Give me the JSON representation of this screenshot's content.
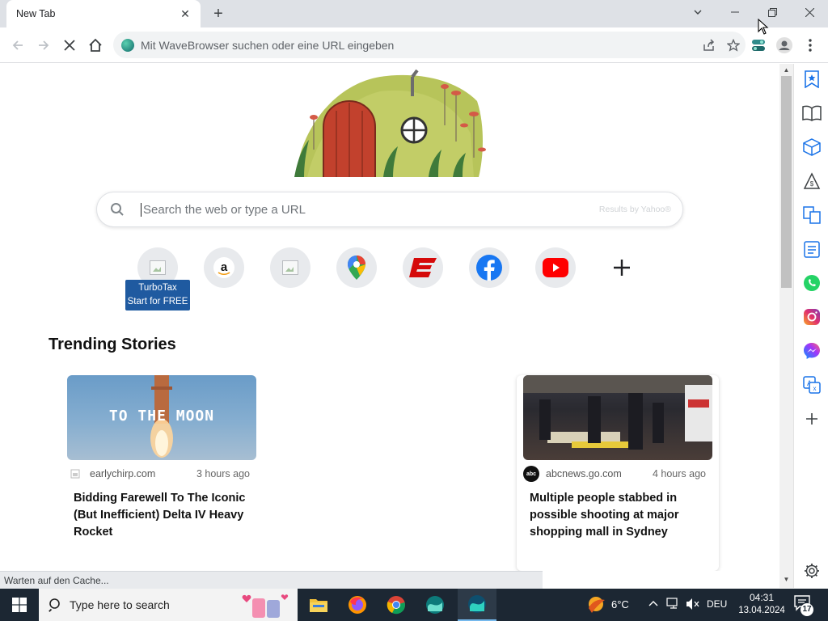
{
  "tab": {
    "title": "New Tab",
    "close": "✕",
    "new": "+"
  },
  "window": {
    "minimize": "—",
    "restore": "❐",
    "close": "✕"
  },
  "toolbar": {
    "omnibox_placeholder": "Mit WaveBrowser suchen oder eine URL eingeben"
  },
  "search": {
    "placeholder": "Search the web or type a URL",
    "provider_note": "Results by Yahoo®"
  },
  "shortcuts": [
    {
      "name": "TurboTax",
      "icon": "broken-image-icon",
      "tooltip_line1": "TurboTax",
      "tooltip_line2": "Start for FREE"
    },
    {
      "name": "Amazon",
      "icon": "amazon-icon",
      "glyph": "a"
    },
    {
      "name": "Shortcut",
      "icon": "broken-image-icon"
    },
    {
      "name": "Google Maps",
      "icon": "maps-pin-icon"
    },
    {
      "name": "ESPN",
      "icon": "espn-icon",
      "glyph": "E"
    },
    {
      "name": "Facebook",
      "icon": "facebook-icon",
      "glyph": "f"
    },
    {
      "name": "YouTube",
      "icon": "youtube-icon"
    },
    {
      "name": "Add shortcut",
      "icon": "plus-icon",
      "glyph": "+"
    }
  ],
  "trending": {
    "title": "Trending Stories",
    "stories": [
      {
        "image_caption": "TO THE MOON",
        "source": "earlychirp.com",
        "time": "3 hours ago",
        "headline": "Bidding Farewell To The Iconic (But Inefficient) Delta IV Heavy Rocket"
      },
      {
        "source_logo": "abc",
        "source": "abcnews.go.com",
        "time": "4 hours ago",
        "headline": "Multiple people stabbed in possible shooting at major shopping mall in Sydney"
      }
    ]
  },
  "status_bar": "Warten auf den Cache...",
  "sidebar_icons": [
    "bookmark-star-icon",
    "reading-list-icon",
    "box-icon",
    "shopping-icon",
    "translate-pages-icon",
    "checklist-icon",
    "whatsapp-icon",
    "instagram-icon",
    "messenger-icon",
    "translate-icon",
    "add-icon",
    "settings-icon"
  ],
  "taskbar": {
    "search_placeholder": "Type here to search",
    "weather": "6°C",
    "language": "DEU",
    "time": "04:31",
    "date": "13.04.2024",
    "notifications": "17"
  },
  "colors": {
    "accent": "#1f5aa0",
    "taskbar": "#1c2733",
    "tabstrip": "#dee1e6"
  }
}
